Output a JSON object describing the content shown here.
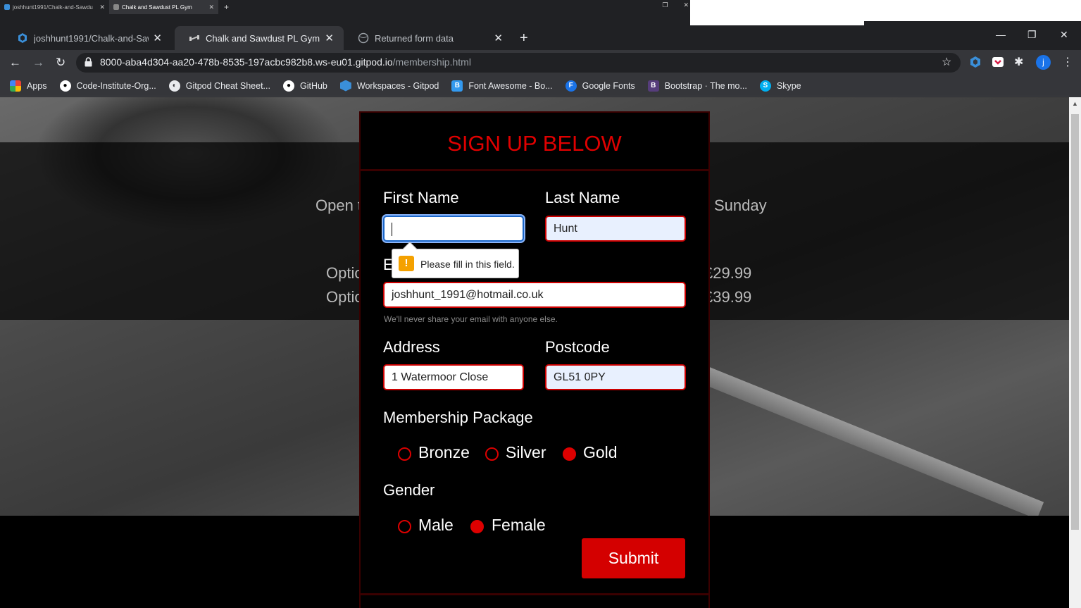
{
  "mini_tabs": [
    {
      "label": "joshhunt1991/Chalk-and-Sawdu"
    },
    {
      "label": "Chalk and Sawdust PL Gym"
    }
  ],
  "tabs": [
    {
      "label": "joshhunt1991/Chalk-and-Sawdu"
    },
    {
      "label": "Chalk and Sawdust PL Gym"
    },
    {
      "label": "Returned form data"
    }
  ],
  "address_bar": {
    "host": "8000-aba4d304-aa20-478b-8535-197acbc982b8.ws-eu01.gitpod.io",
    "path": "/membership.html"
  },
  "avatar_letter": "j",
  "bookmarks": [
    {
      "label": "Apps",
      "icon": "apps-grid-icon"
    },
    {
      "label": "Code-Institute-Org...",
      "icon": "github-icon"
    },
    {
      "label": "Gitpod Cheat Sheet...",
      "icon": "globe-icon"
    },
    {
      "label": "GitHub",
      "icon": "github-icon"
    },
    {
      "label": "Workspaces - Gitpod",
      "icon": "gitpod-icon"
    },
    {
      "label": "Font Awesome - Bo...",
      "icon": "fontawesome-icon"
    },
    {
      "label": "Google Fonts",
      "icon": "google-fonts-icon"
    },
    {
      "label": "Bootstrap · The mo...",
      "icon": "bootstrap-icon"
    },
    {
      "label": "Skype",
      "icon": "skype-icon"
    }
  ],
  "background_text": {
    "open_left": "Open t",
    "open_right": "Sunday",
    "option1_left": "Optio",
    "option1_right": "£29.99",
    "option2_left": "Optio",
    "option2_right": "£39.99"
  },
  "form": {
    "title": "SIGN UP BELOW",
    "first_name_label": "First Name",
    "first_name_value": "",
    "last_name_label": "Last Name",
    "last_name_value": "Hunt",
    "email_label_visible": "E",
    "email_value": "joshhunt_1991@hotmail.co.uk",
    "email_help": "We'll never share your email with anyone else.",
    "address_label": "Address",
    "address_value": "1 Watermoor Close",
    "postcode_label": "Postcode",
    "postcode_value": "GL51 0PY",
    "membership_label": "Membership Package",
    "membership_options": [
      "Bronze",
      "Silver",
      "Gold"
    ],
    "membership_selected": "Gold",
    "gender_label": "Gender",
    "gender_options": [
      "Male",
      "Female"
    ],
    "gender_selected": "Female",
    "submit_label": "Submit"
  },
  "validation_tooltip": "Please fill in this field.",
  "colors": {
    "accent_red": "#e00000",
    "button_red": "#d40000",
    "focus_blue": "#1a66c8",
    "warning_orange": "#f4a100"
  }
}
